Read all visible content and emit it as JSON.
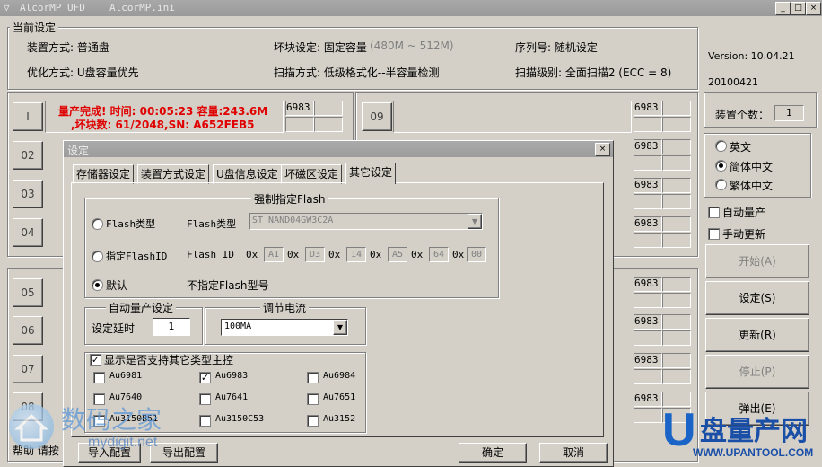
{
  "window": {
    "title": "AlcorMP_UFD",
    "ini": "AlcorMP.ini",
    "min": "_",
    "max": "□",
    "close": "×"
  },
  "settings": {
    "group_title": "当前设定",
    "install_mode": "装置方式: 普通盘",
    "bad_block": "坏块设定: 固定容量",
    "bad_block_range": "(480M ~ 512M)",
    "serial": "序列号: 随机设定",
    "optimize": "优化方式: U盘容量优先",
    "scan_mode": "扫描方式: 低级格式化--半容量检测",
    "scan_level": "扫描级别: 全面扫描2 (ECC = 8)"
  },
  "version": {
    "ver": "Version: 10.04.21",
    "date": "20100421"
  },
  "ports": {
    "p1_label": "I",
    "p1_status_line1": "量产完成! 时间: 00:05:23 容量:243.6M",
    "p1_status_line2": ",坏块数: 61/2048,SN: A652FEB5",
    "p1_code": "6983",
    "p9_label": "09",
    "p9_code": "6983",
    "left_labels": [
      "02",
      "03",
      "04",
      "05",
      "06",
      "07",
      "08"
    ],
    "right_codes": [
      "6983",
      "6983",
      "6983",
      "6983",
      "6983",
      "6983",
      "6983"
    ]
  },
  "sidepanel": {
    "device_count_label": "装置个数：",
    "device_count": "1",
    "lang": [
      "英文",
      "简体中文",
      "繁体中文"
    ],
    "auto_mp": "自动量产",
    "manual_update": "手动更新",
    "start": "开始(A)",
    "settings": "设定(S)",
    "refresh": "更新(R)",
    "stop": "停止(P)",
    "eject": "弹出(E)"
  },
  "bottom": {
    "help": "帮助  请按"
  },
  "dialog": {
    "title": "设定",
    "close": "×",
    "tabs": [
      "存储器设定",
      "装置方式设定",
      "U盘信息设定",
      "坏磁区设定",
      "其它设定"
    ],
    "flash_group": "强制指定Flash",
    "opt_flash_type": "Flash类型",
    "flash_type_label": "Flash类型",
    "flash_type_value": "ST NAND04GW3C2A",
    "opt_flash_id": "指定FlashID",
    "flash_id_label": "Flash  ID",
    "hex_prefix": "0x",
    "flash_id": [
      "A1",
      "D3",
      "14",
      "A5",
      "64",
      "00"
    ],
    "opt_default": "默认",
    "default_note": "不指定Flash型号",
    "auto_group": "自动量产设定",
    "delay_label": "设定延时",
    "delay_value": "1",
    "current_group": "调节电流",
    "current_value": "100MA",
    "support_title": "显示是否支持其它类型主控",
    "controllers": [
      [
        "Au6981",
        "Au6983",
        "Au6984"
      ],
      [
        "Au7640",
        "Au7641",
        "Au7651"
      ],
      [
        "Au3150B51",
        "Au3150C53",
        "Au3152"
      ]
    ],
    "import": "导入配置",
    "export": "导出配置",
    "ok": "确定",
    "cancel": "取消"
  },
  "watermarks": {
    "left_cn": "数码之家",
    "left_url": "mydigit.net",
    "right_cn": "盘量产网",
    "right_url": "WWW.UPANTOOL.COM",
    "right_letter": "U"
  }
}
